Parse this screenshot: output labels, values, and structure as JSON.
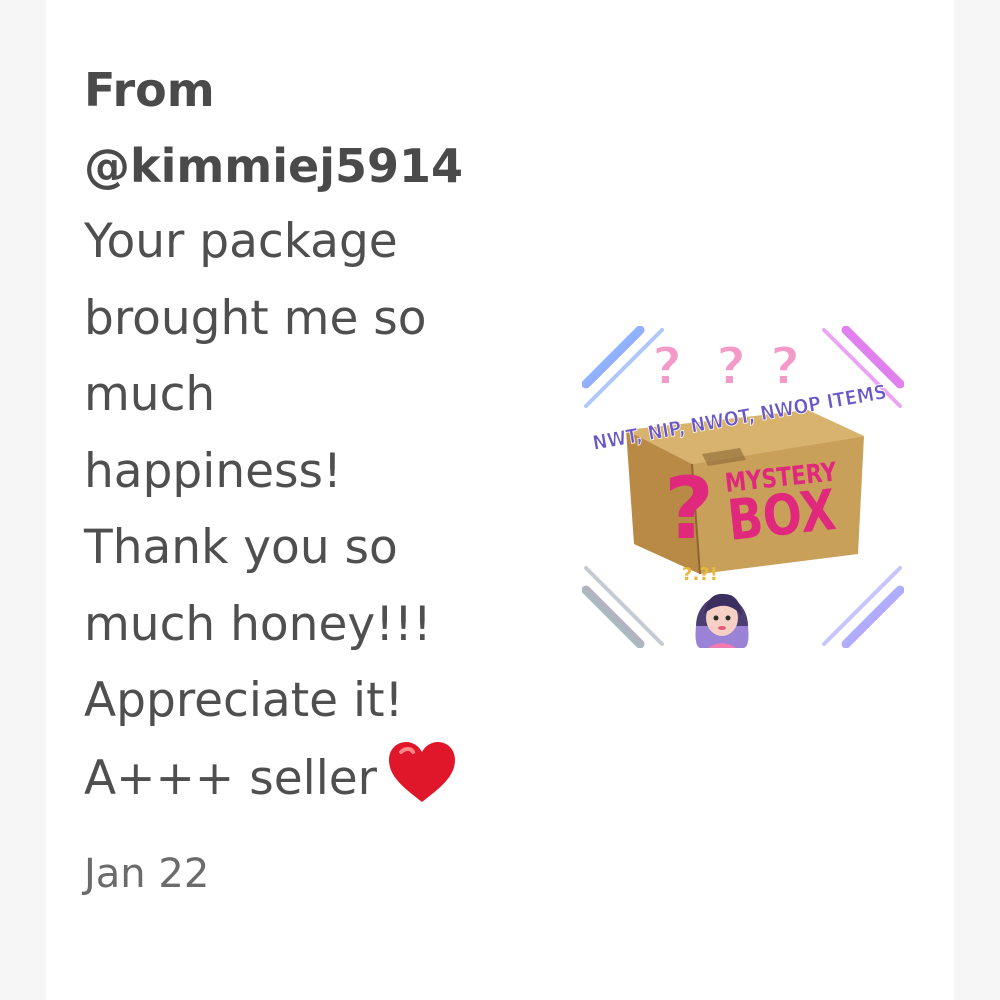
{
  "review": {
    "from_label": "From",
    "username": "@kimmiej5914",
    "message_lines": [
      "Your package",
      "brought me so",
      "much",
      "happiness!",
      "Thank you so",
      "much honey!!!",
      "Appreciate it!",
      "A+++ seller"
    ],
    "heart_icon": "red-heart-icon",
    "date": "Jan 22"
  },
  "listing_image": {
    "top_marks": [
      "?",
      "?",
      "?"
    ],
    "banner_text": "NWT, NIP, NWOT, NWOP ITEMS",
    "box_question": "?",
    "box_word_1": "MYSTERY",
    "box_word_2": "BOX",
    "small_marks": "?.?!",
    "colors": {
      "box": "#c9a05a",
      "box_text": "#e0287c",
      "banner_text": "#6a58c8",
      "question_marks": "#f49ac9"
    }
  }
}
